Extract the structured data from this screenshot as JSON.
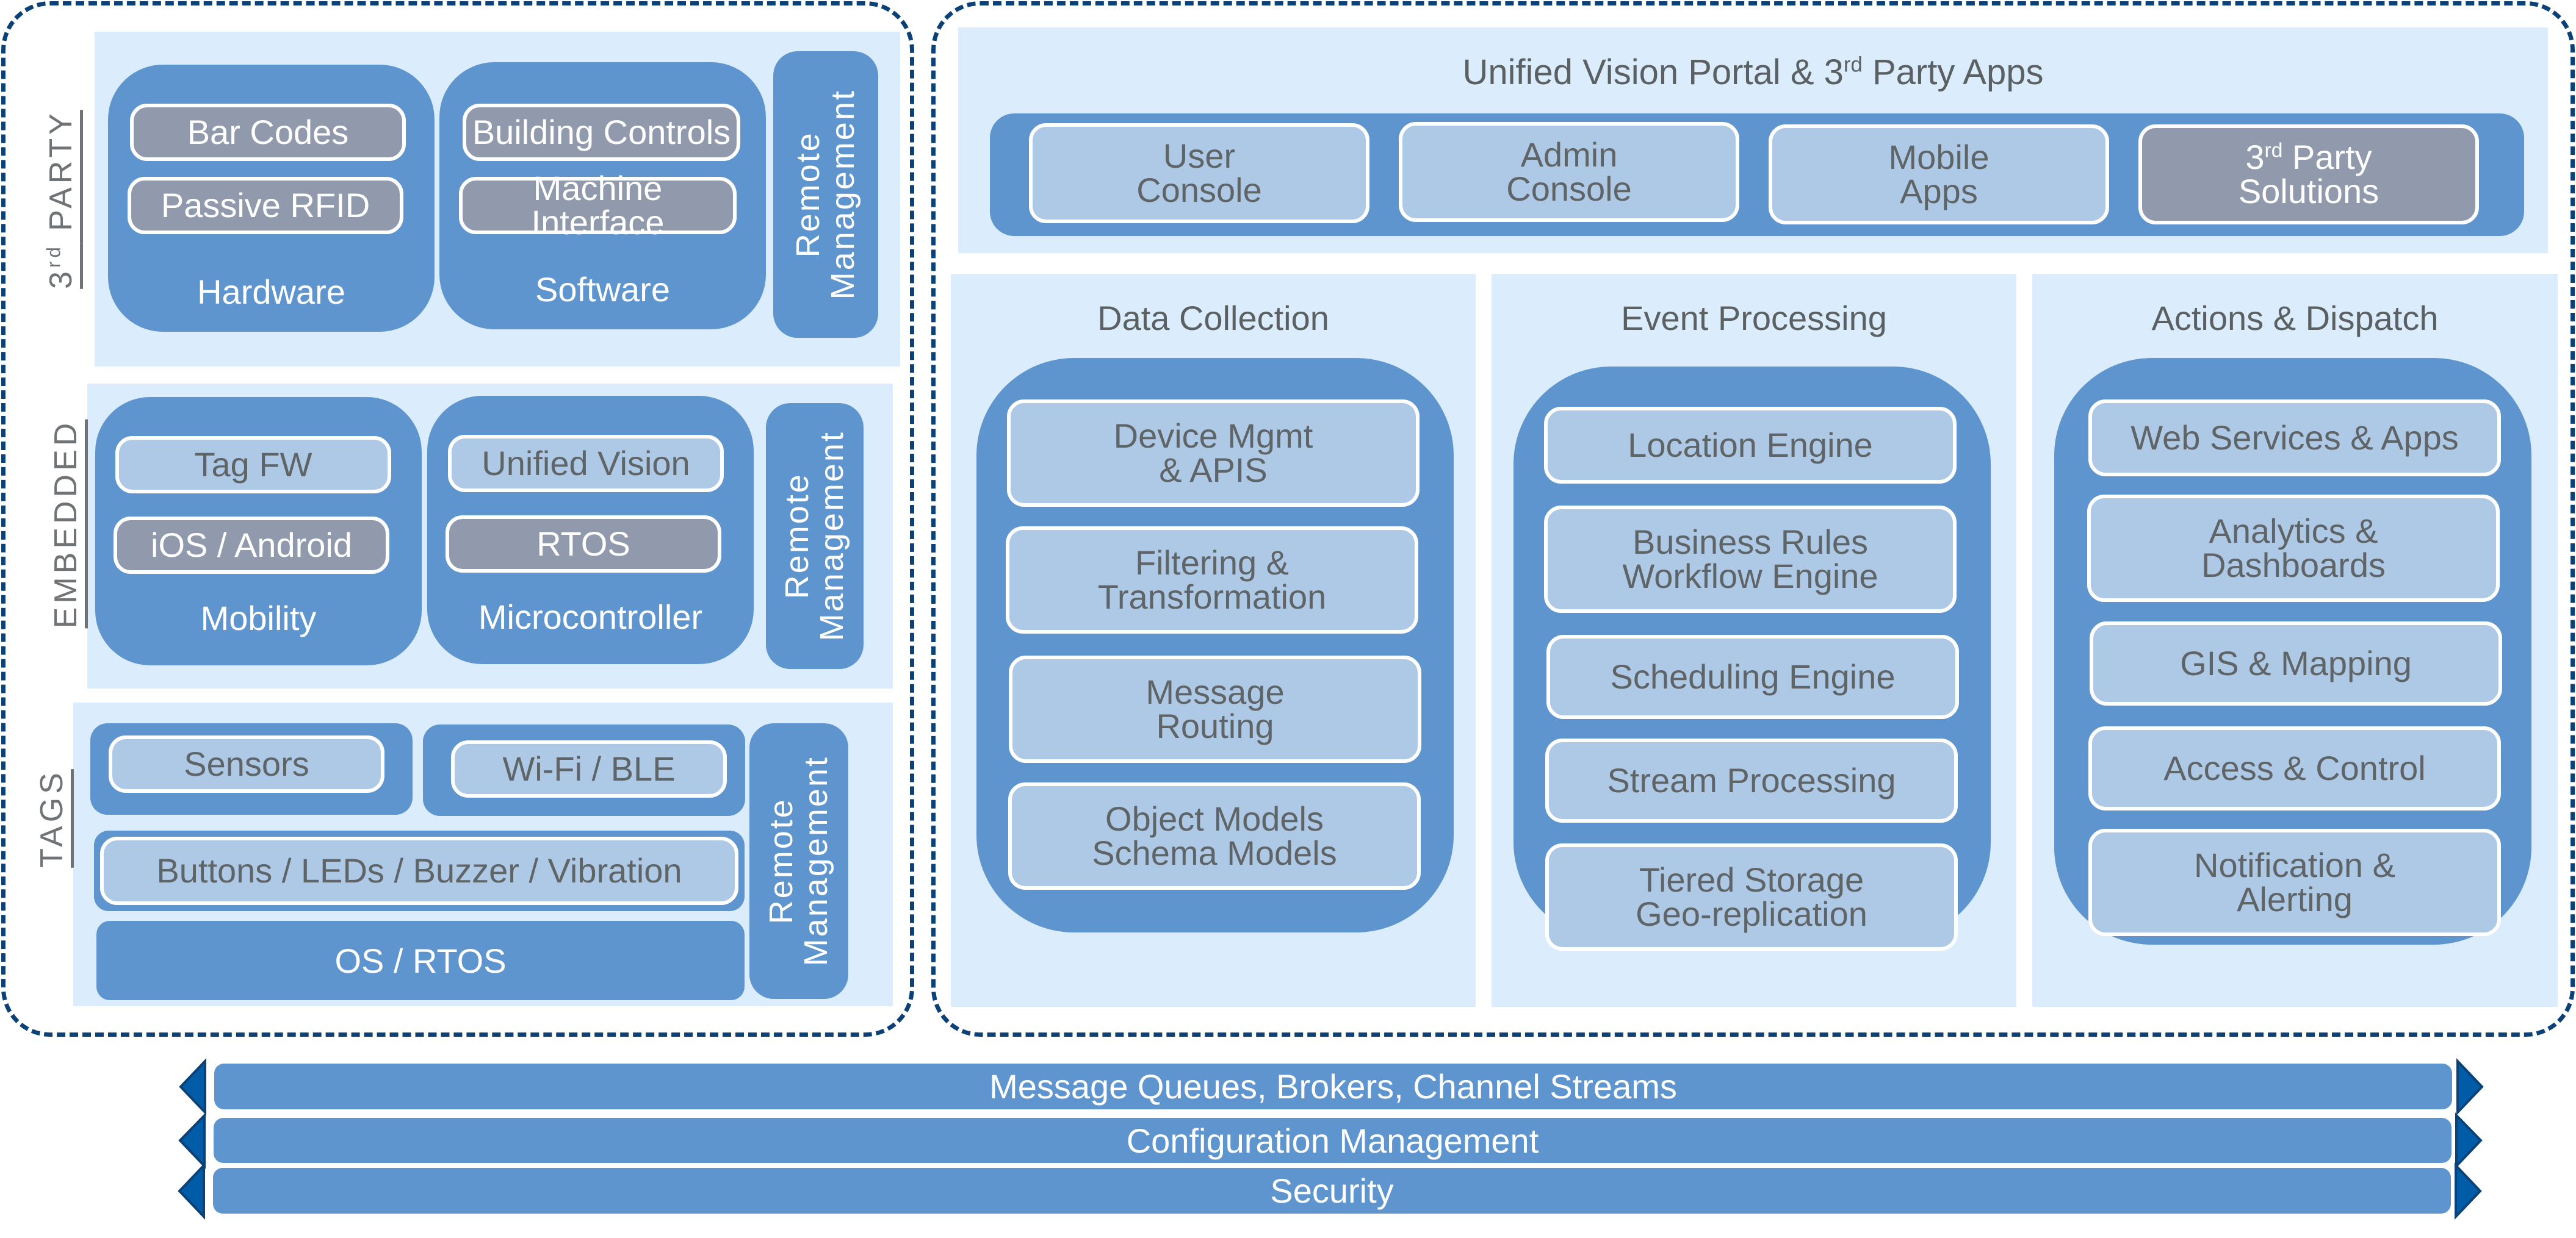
{
  "left": {
    "third_party": {
      "label": "3rd PARTY",
      "hardware": {
        "label": "Hardware",
        "items": [
          "Bar Codes",
          "Passive RFID"
        ]
      },
      "software": {
        "label": "Software",
        "items": [
          "Building Controls",
          "Machine Interface"
        ]
      },
      "remote": "Remote\nManagement"
    },
    "embedded": {
      "label": "EMBEDDED",
      "mobility": {
        "label": "Mobility",
        "items": [
          "Tag FW",
          "iOS / Android"
        ]
      },
      "microcontroller": {
        "label": "Microcontroller",
        "items": [
          "Unified Vision",
          "RTOS"
        ]
      },
      "remote": "Remote\nManagement"
    },
    "tags": {
      "label": "TAGS",
      "sensors": "Sensors",
      "wifi": "Wi-Fi / BLE",
      "buttons": "Buttons / LEDs / Buzzer / Vibration",
      "os": "OS / RTOS",
      "remote": "Remote\nManagement"
    }
  },
  "portal": {
    "title_pre": "Unified Vision Portal & 3",
    "title_sup": "rd",
    "title_post": " Party Apps",
    "items": [
      "User\nConsole",
      "Admin\nConsole",
      "Mobile\nApps"
    ],
    "third_party_sup": "rd",
    "third_party_pre": "3",
    "third_party_post": " Party",
    "third_party_line2": "Solutions"
  },
  "columns": [
    {
      "title": "Data Collection",
      "items": [
        "Device Mgmt\n& APIS",
        "Filtering &\nTransformation",
        "Message\nRouting",
        "Object Models\nSchema Models"
      ]
    },
    {
      "title": "Event Processing",
      "items": [
        "Location Engine",
        "Business Rules\nWorkflow Engine",
        "Scheduling Engine",
        "Stream Processing",
        "Tiered Storage\nGeo-replication"
      ]
    },
    {
      "title": "Actions & Dispatch",
      "items": [
        "Web Services & Apps",
        "Analytics &\nDashboards",
        "GIS & Mapping",
        "Access & Control",
        "Notification &\nAlerting"
      ]
    }
  ],
  "bars": [
    "Message Queues, Brokers, Channel Streams",
    "Configuration Management",
    "Security"
  ],
  "colors": {
    "panel": "#dbedfc",
    "group": "#5e95cf",
    "pill": "#aec9e6",
    "pill_gray": "#9199ac",
    "border": "#0b4176",
    "arrow": "#005ca7"
  }
}
